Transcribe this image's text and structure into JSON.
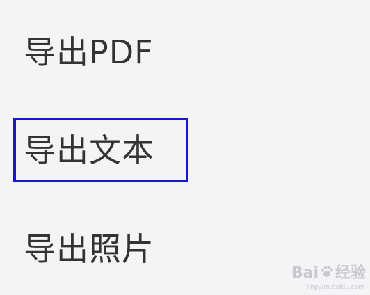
{
  "menu": {
    "items": [
      {
        "label": "导出PDF"
      },
      {
        "label": "导出文本"
      },
      {
        "label": "导出照片"
      }
    ]
  },
  "highlight": {
    "color": "#1a16d0"
  },
  "watermark": {
    "brand_left": "Bai",
    "brand_right": "经验",
    "url": "jingyan.baidu.com"
  }
}
